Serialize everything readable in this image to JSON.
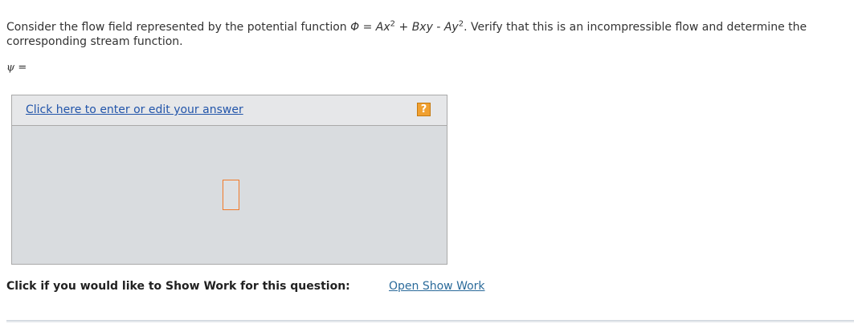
{
  "question": {
    "text_before_phi": "Consider the flow field represented by the potential function ",
    "phi_symbol": "Φ",
    "equals": " = ",
    "term1": "Ax",
    "exp1": "2",
    "plus": " + ",
    "term2": "Bxy",
    "minus": " - ",
    "term3": "Ay",
    "exp3": "2",
    "text_after": ". Verify that this is an incompressible flow and determine the corresponding stream function."
  },
  "answer": {
    "psi_symbol": "ψ",
    "psi_equals": " =",
    "edit_link": "Click here to enter or edit your answer",
    "help_icon": "?"
  },
  "show_work": {
    "prompt": "Click if you would like to Show Work for this question:",
    "link": "Open Show Work"
  },
  "colors": {
    "link": "#2255aa",
    "help_icon": "#f0a030",
    "cursor_border": "#f07a2a",
    "answer_bg": "#d9dcdf"
  }
}
